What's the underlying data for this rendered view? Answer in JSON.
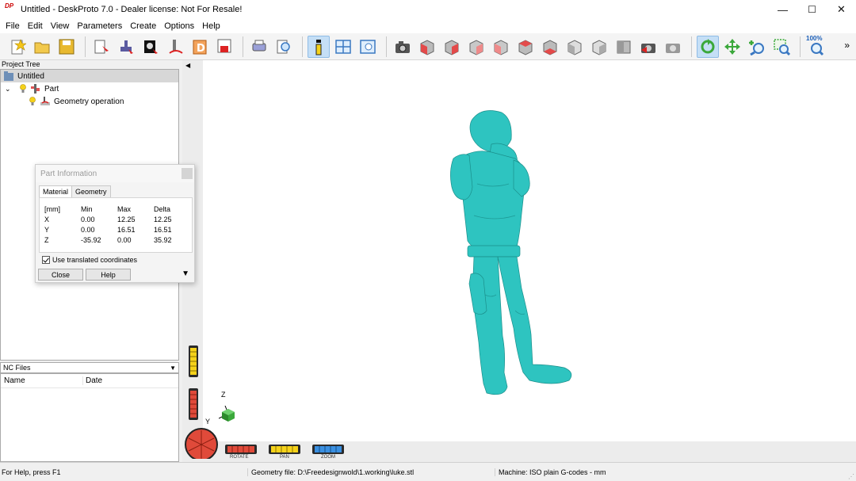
{
  "window": {
    "title": "Untitled - DeskProto 7.0 - Dealer license: Not For Resale!",
    "logo_text": "DP",
    "minimize": "—",
    "maximize": "☐",
    "close": "✕"
  },
  "menu": [
    "File",
    "Edit",
    "View",
    "Parameters",
    "Create",
    "Options",
    "Help"
  ],
  "toolbar": {
    "zoom_label": "100%",
    "overflow": "»"
  },
  "project_tree": {
    "header": "Project Tree",
    "root": "Untitled",
    "part": "Part",
    "operation": "Geometry operation"
  },
  "nc_files": {
    "header": "NC Files",
    "col_name": "Name",
    "col_date": "Date"
  },
  "part_info": {
    "title": "Part Information",
    "tabs": [
      "Material",
      "Geometry"
    ],
    "active_tab": "Material",
    "headers": [
      "[mm]",
      "Min",
      "Max",
      "Delta"
    ],
    "rows": [
      {
        "axis": "X",
        "min": "0.00",
        "max": "12.25",
        "delta": "12.25"
      },
      {
        "axis": "Y",
        "min": "0.00",
        "max": "16.51",
        "delta": "16.51"
      },
      {
        "axis": "Z",
        "min": "-35.92",
        "max": "0.00",
        "delta": "35.92"
      }
    ],
    "checkbox_label": "Use translated coordinates",
    "checkbox_checked": true,
    "close_label": "Close",
    "help_label": "Help"
  },
  "viewport": {
    "axis_z": "Z",
    "axis_y": "Y",
    "rotate_label": "ROTATE",
    "pan_label": "PAN",
    "zoom_label": "ZOOM",
    "model_color": "#2ec4c0"
  },
  "status": {
    "help": "For Help, press F1",
    "geometry": "Geometry file: D:\\Freedesignwold\\1.working\\luke.stl",
    "machine": "Machine: ISO plain G-codes - mm"
  }
}
